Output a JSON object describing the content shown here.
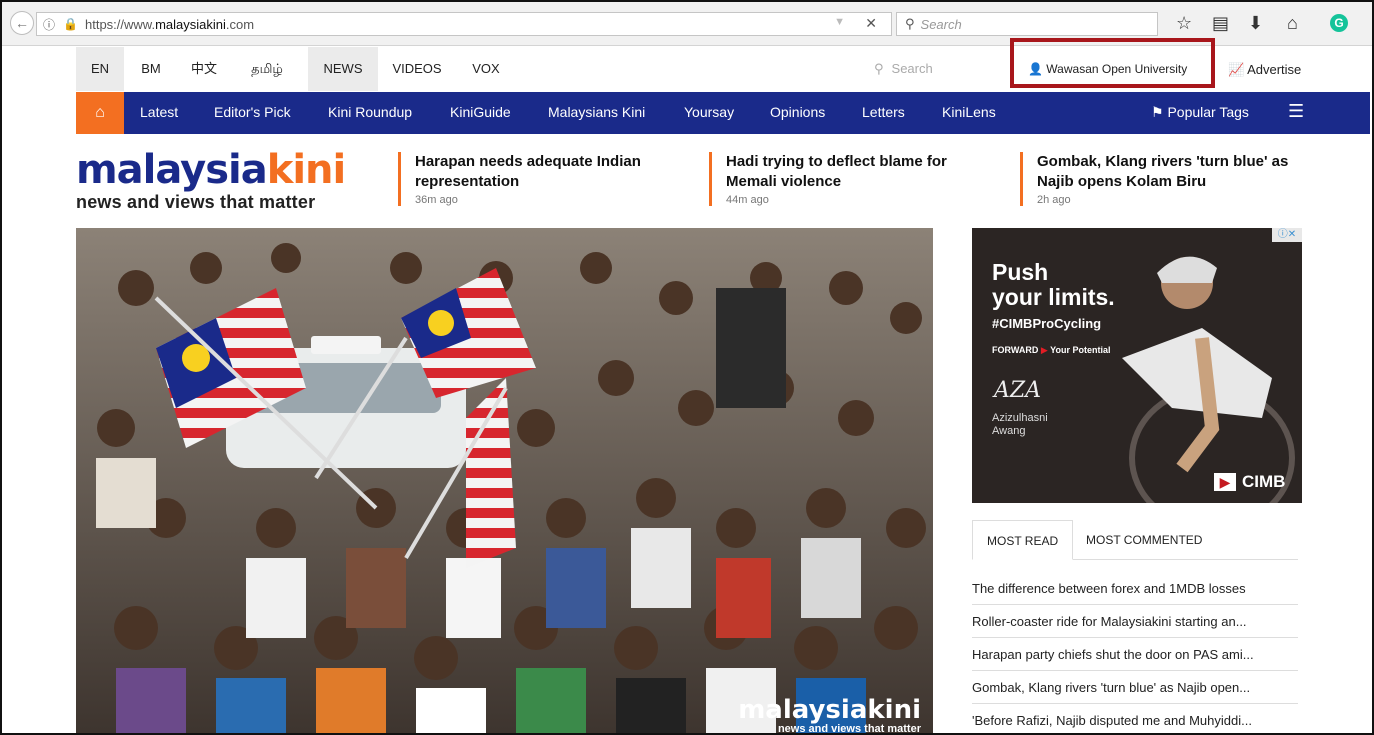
{
  "browser": {
    "url_prefix": "https://www.",
    "url_domain": "malaysiakini",
    "url_suffix": ".com",
    "search_placeholder": "Search",
    "icons": [
      "back-arrow-icon",
      "info-icon",
      "lock-icon",
      "close-icon",
      "search-icon",
      "bookmark-star-icon",
      "reading-list-icon",
      "download-icon",
      "home-icon",
      "grammarly-icon"
    ]
  },
  "langbar": {
    "languages": [
      "EN",
      "BM",
      "中文",
      "தமிழ்"
    ],
    "sections": [
      "NEWS",
      "VIDEOS",
      "VOX"
    ],
    "search_label": "Search",
    "login_label": "Wawasan Open University",
    "advertise_label": "Advertise"
  },
  "nav": {
    "items": [
      "Latest",
      "Editor's Pick",
      "Kini Roundup",
      "KiniGuide",
      "Malaysians Kini",
      "Yoursay",
      "Opinions",
      "Letters",
      "KiniLens"
    ],
    "popular_tags": "Popular Tags",
    "accent": "#f36f21",
    "background": "#1a2a8a"
  },
  "logo": {
    "word_main": "malaysia",
    "word_accent": "kini",
    "tagline": "news and views that matter"
  },
  "headlines": [
    {
      "title": "Harapan needs adequate Indian representation",
      "time": "36m ago"
    },
    {
      "title": "Hadi trying to deflect blame for Memali violence",
      "time": "44m ago"
    },
    {
      "title": "Gombak, Klang rivers 'turn blue' as Najib opens Kolam Biru",
      "time": "2h ago"
    }
  ],
  "hero": {
    "watermark_main": "malaysiakini",
    "watermark_tag": "news and views that matter"
  },
  "ad": {
    "line1": "Push",
    "line2": "your limits.",
    "hashtag": "#CIMBProCycling",
    "forward_prefix": "FORWARD",
    "forward_suffix": "Your Potential",
    "signature": "AZA",
    "rider_first": "Azizulhasni",
    "rider_last": "Awang",
    "brand": "CIMB",
    "adchoice": "ⓘ✕"
  },
  "most_read": {
    "tabs": [
      "MOST READ",
      "MOST COMMENTED"
    ],
    "items": [
      "The difference between forex and 1MDB losses",
      "Roller-coaster ride for Malaysiakini starting an...",
      "Harapan party chiefs shut the door on PAS ami...",
      "Gombak, Klang rivers 'turn blue' as Najib open...",
      "'Before Rafizi, Najib disputed me and Muhyiddi..."
    ]
  }
}
